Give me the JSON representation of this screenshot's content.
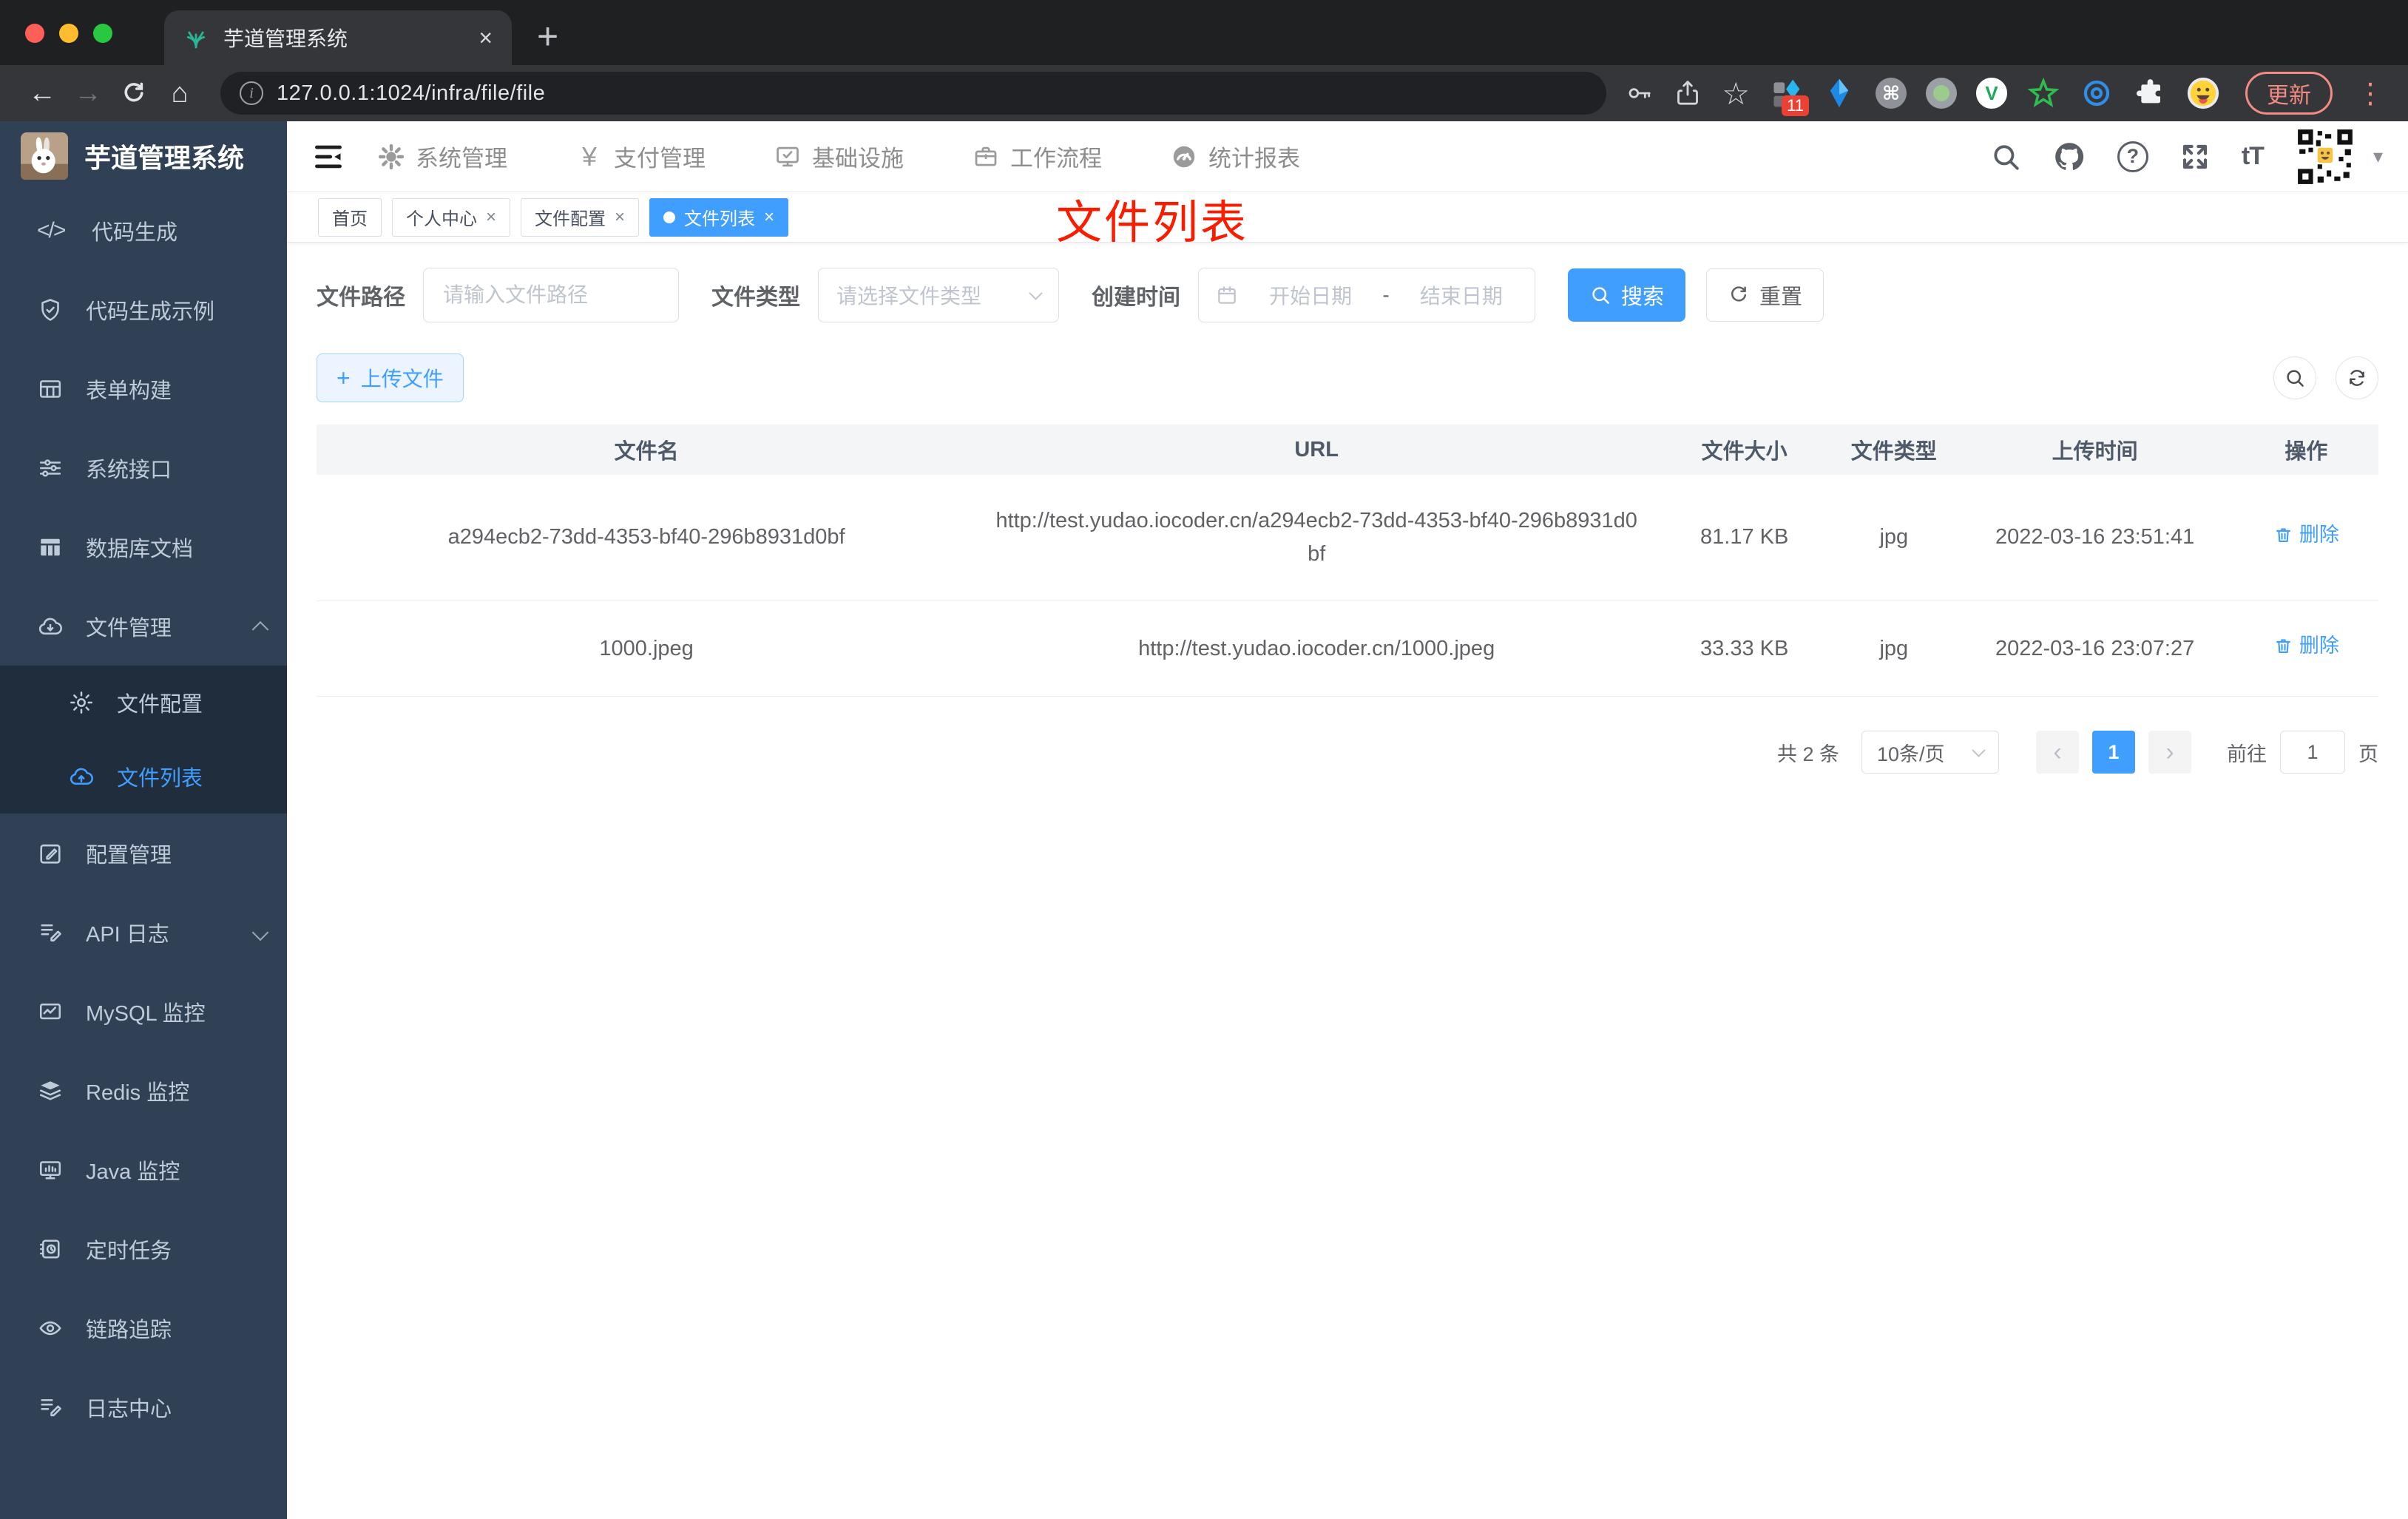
{
  "colors": {
    "accent": "#409eff",
    "sidebar_bg": "#304156",
    "submenu_bg": "#1f2d3d",
    "annotation_red": "#f81d00",
    "traffic_red": "#ff5f57",
    "traffic_yellow": "#febc2e",
    "traffic_green": "#28c840",
    "update_red": "#f28b82"
  },
  "browser": {
    "tab_title": "芋道管理系统",
    "close_glyph": "×",
    "new_tab_glyph": "+",
    "back_glyph": "←",
    "forward_glyph": "→",
    "home_glyph": "⌂",
    "url": "127.0.0.1:1024/infra/file/file",
    "star_glyph": "☆",
    "ext_badge": "11",
    "ext_v_glyph": "V",
    "cmd_glyph": "⌘",
    "update_label": "更新",
    "menu_dots_glyph": "⋮"
  },
  "sidebar": {
    "title": "芋道管理系统",
    "code_glyph": "</>",
    "items": [
      {
        "label": "代码生成"
      },
      {
        "label": "代码生成示例"
      },
      {
        "label": "表单构建"
      },
      {
        "label": "系统接口"
      },
      {
        "label": "数据库文档"
      },
      {
        "label": "文件管理",
        "children": [
          {
            "label": "文件配置"
          },
          {
            "label": "文件列表",
            "active": true
          }
        ]
      },
      {
        "label": "配置管理"
      },
      {
        "label": "API 日志"
      },
      {
        "label": "MySQL 监控"
      },
      {
        "label": "Redis 监控"
      },
      {
        "label": "Java 监控"
      },
      {
        "label": "定时任务"
      },
      {
        "label": "链路追踪"
      },
      {
        "label": "日志中心"
      }
    ]
  },
  "topnav": {
    "yen_glyph": "¥",
    "font_size_glyph": "tT",
    "question_glyph": "?",
    "avatar_caret_glyph": "▾",
    "items": [
      {
        "label": "系统管理"
      },
      {
        "label": "支付管理"
      },
      {
        "label": "基础设施"
      },
      {
        "label": "工作流程"
      },
      {
        "label": "统计报表"
      }
    ]
  },
  "tags": {
    "close_glyph": "×",
    "items": [
      {
        "label": "首页",
        "closable": false,
        "active": false
      },
      {
        "label": "个人中心",
        "closable": true,
        "active": false
      },
      {
        "label": "文件配置",
        "closable": true,
        "active": false
      },
      {
        "label": "文件列表",
        "closable": true,
        "active": true
      }
    ]
  },
  "annotation": {
    "text": "文件列表"
  },
  "filter": {
    "path_label": "文件路径",
    "path_placeholder": "请输入文件路径",
    "type_label": "文件类型",
    "type_placeholder": "请选择文件类型",
    "date_label": "创建时间",
    "date_start_placeholder": "开始日期",
    "date_separator": "-",
    "date_end_placeholder": "结束日期",
    "search_label": "搜索",
    "reset_label": "重置"
  },
  "actions": {
    "upload_plus_glyph": "+",
    "upload_label": "上传文件"
  },
  "table": {
    "columns": [
      "文件名",
      "URL",
      "文件大小",
      "文件类型",
      "上传时间",
      "操作"
    ],
    "rows": [
      {
        "name": "a294ecb2-73dd-4353-bf40-296b8931d0bf",
        "url": "http://test.yudao.iocoder.cn/a294ecb2-73dd-4353-bf40-296b8931d0bf",
        "size": "81.17 KB",
        "type": "jpg",
        "time": "2022-03-16 23:51:41",
        "action": "删除"
      },
      {
        "name": "1000.jpeg",
        "url": "http://test.yudao.iocoder.cn/1000.jpeg",
        "size": "33.33 KB",
        "type": "jpg",
        "time": "2022-03-16 23:07:27",
        "action": "删除"
      }
    ]
  },
  "pagination": {
    "total": "共 2 条",
    "page_size": "10条/页",
    "prev_glyph": "‹",
    "current_page": "1",
    "next_glyph": "›",
    "goto_label": "前往",
    "goto_value": "1",
    "unit_label": "页"
  }
}
